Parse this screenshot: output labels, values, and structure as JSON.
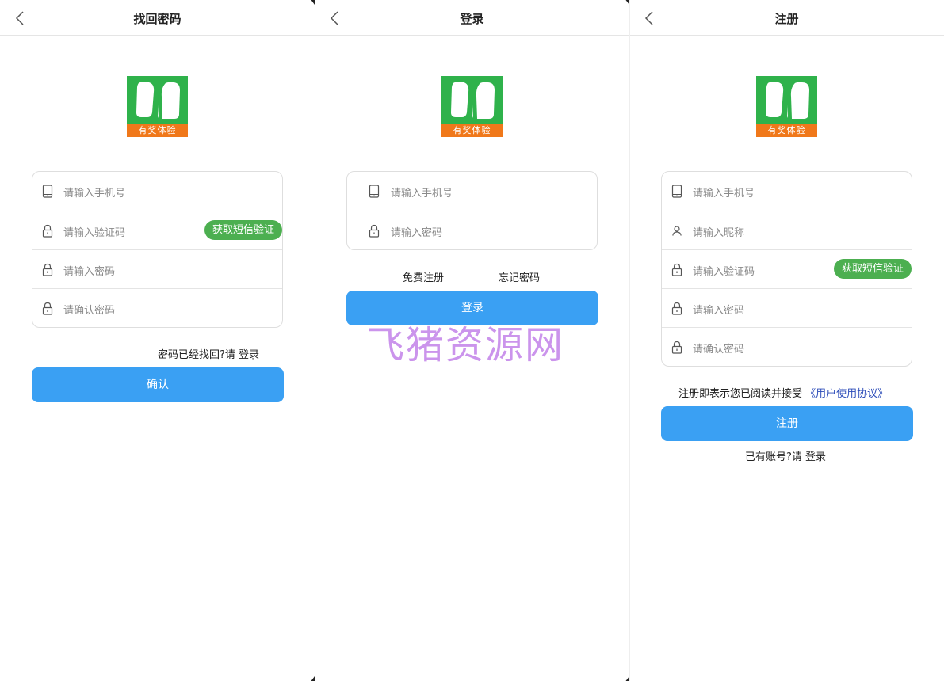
{
  "colors": {
    "primary_button": "#3aa0f3",
    "sms_button": "#4caf50",
    "logo_green": "#2fb24b",
    "logo_orange": "#f0781a",
    "agreement_link": "#2b4bb8",
    "watermark": "#a03cdc"
  },
  "logo": {
    "caption": "有奖体验"
  },
  "screens": {
    "forgot": {
      "title": "找回密码",
      "fields": [
        {
          "icon": "phone-icon",
          "placeholder": "请输入手机号"
        },
        {
          "icon": "lock-icon",
          "placeholder": "请输入验证码"
        },
        {
          "icon": "lock-icon",
          "placeholder": "请输入密码"
        },
        {
          "icon": "lock-icon",
          "placeholder": "请确认密码"
        }
      ],
      "sms_button": "获取短信验证",
      "login_hint": "密码已经找回?请 登录",
      "submit": "确认"
    },
    "login": {
      "title": "登录",
      "fields": [
        {
          "icon": "phone-icon",
          "placeholder": "请输入手机号"
        },
        {
          "icon": "lock-icon",
          "placeholder": "请输入密码"
        }
      ],
      "register_link": "免费注册",
      "forgot_link": "忘记密码",
      "submit": "登录"
    },
    "register": {
      "title": "注册",
      "fields": [
        {
          "icon": "phone-icon",
          "placeholder": "请输入手机号"
        },
        {
          "icon": "user-icon",
          "placeholder": "请输入昵称"
        },
        {
          "icon": "lock-icon",
          "placeholder": "请输入验证码"
        },
        {
          "icon": "lock-icon",
          "placeholder": "请输入密码"
        },
        {
          "icon": "lock-icon",
          "placeholder": "请确认密码"
        }
      ],
      "sms_button": "获取短信验证",
      "agreement_text": "注册即表示您已阅读并接受",
      "agreement_link": "《用户使用协议》",
      "submit": "注册",
      "login_hint": "已有账号?请 登录"
    }
  },
  "watermark": "飞猪资源网"
}
